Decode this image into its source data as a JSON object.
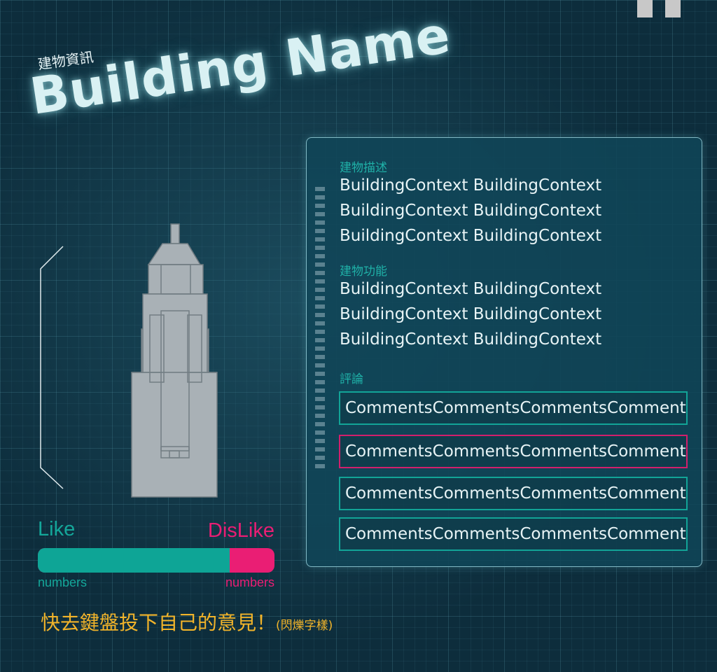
{
  "header": {
    "subtitle": "建物資訊",
    "title": "Building Name"
  },
  "vote": {
    "like_label": "Like",
    "dislike_label": "DisLike",
    "like_count": "numbers",
    "dislike_count": "numbers",
    "like_ratio": 0.81
  },
  "prompt": {
    "main": "快去鍵盤投下自己的意見！",
    "note": "(閃爍字樣)"
  },
  "panel": {
    "description_label": "建物描述",
    "description_lines": [
      "BuildingContext BuildingContext",
      "BuildingContext BuildingContext",
      "BuildingContext BuildingContext"
    ],
    "function_label": "建物功能",
    "function_lines": [
      "BuildingContext BuildingContext",
      "BuildingContext BuildingContext",
      "BuildingContext BuildingContext"
    ],
    "comments_label": "評論",
    "comments": [
      "CommentsCommentsCommentsComments",
      "CommentsCommentsCommentsComments",
      "CommentsCommentsCommentsComments",
      "CommentsCommentsCommentsComments"
    ],
    "selected_comment_index": 1
  },
  "icons": {
    "top_right": "pause-icon",
    "building": "building-model"
  },
  "colors": {
    "like": "#0ea596",
    "dislike": "#ea1e74",
    "prompt": "#f2b42a",
    "label": "#1fb0a7"
  }
}
